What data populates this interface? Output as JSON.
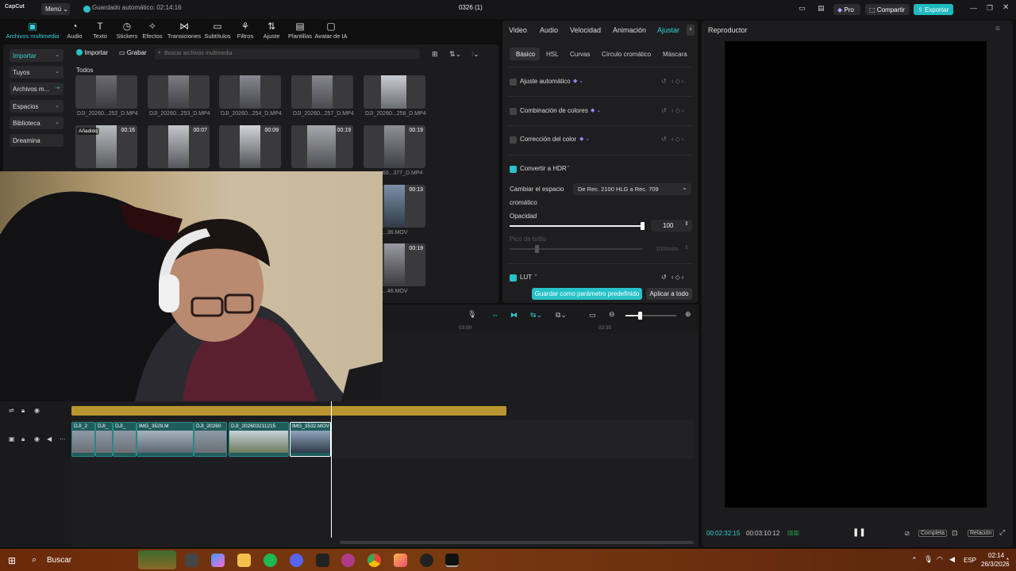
{
  "app": {
    "logo": "CapCut",
    "menu_label": "Menú",
    "autosave": "Guardado automático: 02:14:16",
    "project_title": "0326 (1)",
    "pro_label": "Pro",
    "share_label": "Compartir",
    "export_label": "Exportar"
  },
  "toolbar": {
    "items": [
      {
        "label": "Archivos multimedia",
        "icon": "media-icon"
      },
      {
        "label": "Audio",
        "icon": "audio-icon"
      },
      {
        "label": "Texto",
        "icon": "text-icon"
      },
      {
        "label": "Stickers",
        "icon": "sticker-icon"
      },
      {
        "label": "Efectos",
        "icon": "effects-icon"
      },
      {
        "label": "Transiciones",
        "icon": "transition-icon"
      },
      {
        "label": "Subtítulos",
        "icon": "subtitle-icon"
      },
      {
        "label": "Filtros",
        "icon": "filter-icon"
      },
      {
        "label": "Ajuste",
        "icon": "adjust-icon"
      },
      {
        "label": "Plantillas",
        "icon": "template-icon"
      },
      {
        "label": "Avatar de IA",
        "icon": "avatar-icon"
      }
    ]
  },
  "sidebar": {
    "items": [
      "Importar",
      "Tuyos",
      "Archivos m...",
      "Espacios",
      "Biblioteca",
      "Dreamina"
    ]
  },
  "media": {
    "import_label": "Importar",
    "record_label": "Grabar",
    "search_placeholder": "Buscar archivos multimedia",
    "section_label": "Todos",
    "row1": [
      "DJI_20260...252_D.MP4",
      "DJI_20260...253_D.MP4",
      "DJI_20260...254_D.MP4",
      "DJI_20260...257_D.MP4",
      "DJI_20260...258_D.MP4"
    ],
    "row2_durations": [
      "00:16",
      "00:07",
      "00:09",
      "00:19",
      "00:19"
    ],
    "row2_tag": "Añadido",
    "row2_label_partial": "...60...377_D.MP4",
    "row3_duration": "00:13",
    "row3_label": "...36.MOV",
    "row4_duration": "00:19",
    "row4_label": "...46.MOV"
  },
  "right_panel": {
    "tabs": [
      "Video",
      "Audio",
      "Velocidad",
      "Animación",
      "Ajustar"
    ],
    "active_tab": "Ajustar",
    "sub_tabs": [
      "Básico",
      "HSL",
      "Curvas",
      "Círculo cromático",
      "Máscara"
    ],
    "rows": [
      "Ajuste automático",
      "Combinación de colores",
      "Corrección del color",
      "Convertir a HDR",
      "LUT"
    ],
    "color_space_label_1": "Cambiar el espacio",
    "color_space_label_2": "cromático",
    "color_space_value": "De Rec. 2100 HLG a Rec. 709",
    "opacity_label": "Opacidad",
    "opacity_value": "100",
    "opacity_level": 1.0,
    "peak_label": "Pico de brillo",
    "peak_value": "1000nits",
    "save_preset": "Guardar como parámetro predefinido",
    "apply_all": "Aplicar a todo"
  },
  "player": {
    "title": "Reproductor",
    "current_time": "00:02:32:15",
    "total_time": "00:03:10:12",
    "complete_label": "Completa",
    "ratio_label": "Relación"
  },
  "timeline": {
    "ruler": [
      "03:00",
      "03:30"
    ],
    "clips": [
      "DJI_2",
      "DJI_",
      "DJI_",
      "IMG_3529.M",
      "DJI_20260",
      "DJI_202603211215",
      "IMG_3532.MOV"
    ]
  },
  "taskbar": {
    "search_label": "Buscar",
    "lang": "ESP",
    "time": "02:14",
    "date": "26/3/2026"
  },
  "colors": {
    "accent": "#28c2c9",
    "export": "#1fb9c0",
    "track_gold": "#b8952f",
    "clip_teal": "#1e5d5c"
  }
}
